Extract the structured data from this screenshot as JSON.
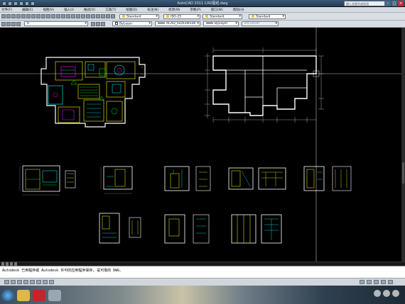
{
  "window": {
    "title": "AutoCAD 2011   CAD图纸.dwg",
    "search_placeholder": "键入关键字或短语"
  },
  "menus": [
    "文件(F)",
    "编辑(E)",
    "视图(V)",
    "插入(I)",
    "格式(O)",
    "工具(T)",
    "绘图(D)",
    "标注(N)",
    "修改(M)",
    "参数(P)",
    "窗口(W)",
    "帮助(H)"
  ],
  "toolbar1": {
    "text_style": "Standard",
    "dim_style": "ISO-25",
    "table_style": "Standard",
    "mleader_style": "Standard"
  },
  "toolbar2": {
    "layer": "0",
    "color": "ByLayer",
    "linetype": "ACAD_ISO03W100",
    "lineweight": "ByLayer",
    "plot_style": "BYCOLOR"
  },
  "command_line": {
    "history": "Autodesk 已用程序或 Autodesk 许可的应用程序保存, 是可靠的 DWG."
  },
  "colors": {
    "drawing_bg": "#000000",
    "wall": "#ffffff",
    "fixture": "#ffff00",
    "furniture": "#00ffff",
    "accent_green": "#00ff00",
    "accent_magenta": "#ff00ff",
    "accent_red": "#ff3030"
  }
}
